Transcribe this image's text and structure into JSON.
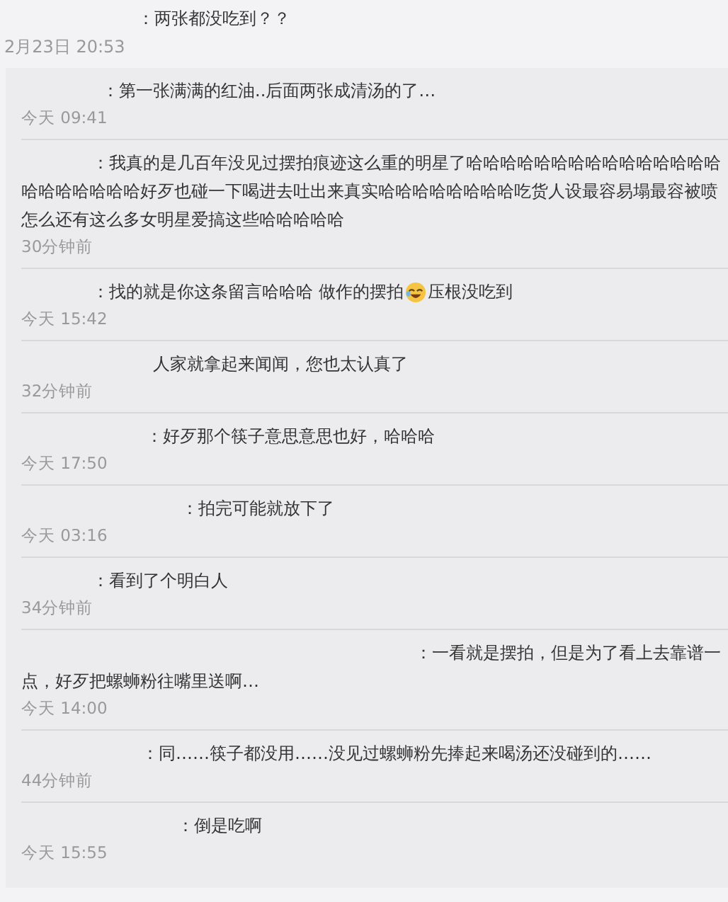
{
  "comment": {
    "text": "：两张都没吃到？？",
    "time": "2月23日 20:53"
  },
  "replies": [
    {
      "text": "：第一张满满的红油..后面两张成清汤的了…",
      "time": "今天 09:41"
    },
    {
      "text": "：我真的是几百年没见过摆拍痕迹这么重的明星了哈哈哈哈哈哈哈哈哈哈哈哈哈哈哈哈哈哈哈哈哈哈好歹也碰一下喝进去吐出来真实哈哈哈哈哈哈哈哈吃货人设最容易塌最容被喷怎么还有这么多女明星爱搞这些哈哈哈哈哈",
      "time": "30分钟前"
    },
    {
      "text": "：找的就是你这条留言哈哈哈 做作的摆拍",
      "text_after_icon": "压根没吃到",
      "time": "今天 15:42"
    },
    {
      "text": "人家就拿起来闻闻，您也太认真了",
      "time": "32分钟前"
    },
    {
      "text": "：好歹那个筷子意思意思也好，哈哈哈",
      "time": "今天 17:50"
    },
    {
      "text": "：拍完可能就放下了",
      "time": "今天 03:16"
    },
    {
      "text": "：看到了个明白人",
      "time": "34分钟前"
    },
    {
      "text": "：一看就是摆拍，但是为了看上去靠谱一点，好歹把螺蛳粉往嘴里送啊…",
      "time": "今天 14:00"
    },
    {
      "text": "：同……筷子都没用……没见过螺蛳粉先捧起来喝汤还没碰到的……",
      "time": "44分钟前"
    },
    {
      "text": "：倒是吃啊",
      "time": "今天 15:55"
    }
  ]
}
